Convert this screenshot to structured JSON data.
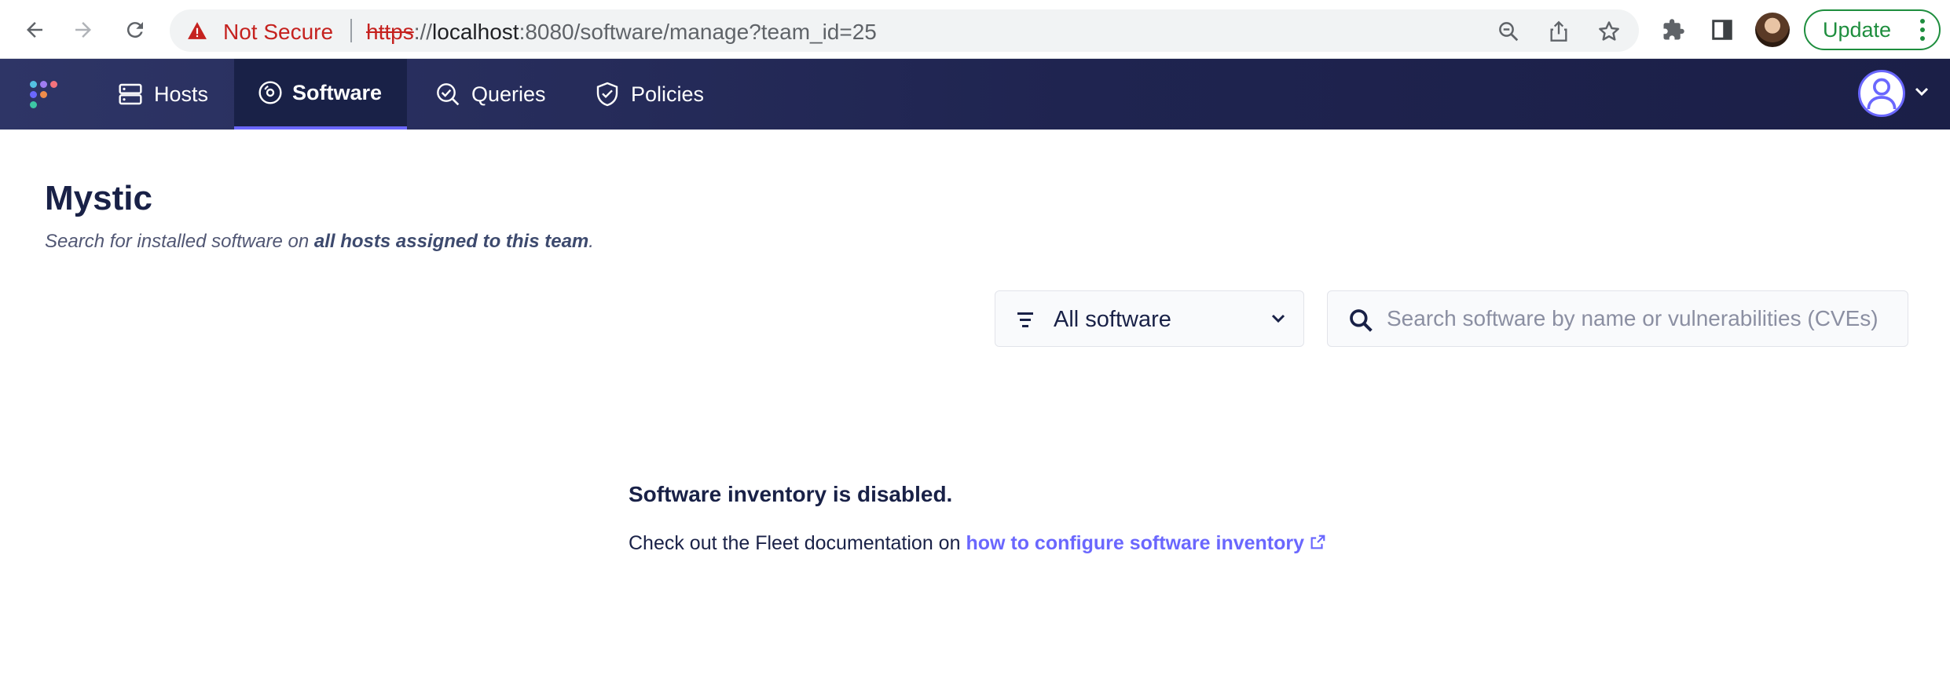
{
  "browser": {
    "security_label": "Not Secure",
    "url_scheme": "https",
    "url_sep": "://",
    "url_host": "localhost",
    "url_rest": ":8080/software/manage?team_id=25",
    "update_label": "Update"
  },
  "nav": {
    "items": [
      {
        "label": "Hosts",
        "icon": "hosts-icon"
      },
      {
        "label": "Software",
        "icon": "software-icon",
        "active": true
      },
      {
        "label": "Queries",
        "icon": "queries-icon"
      },
      {
        "label": "Policies",
        "icon": "policies-icon"
      }
    ]
  },
  "page": {
    "team_name": "Mystic",
    "subtitle_prefix": "Search for installed software on ",
    "subtitle_emphasis": "all hosts assigned to this team",
    "subtitle_suffix": "."
  },
  "filter": {
    "selected": "All software"
  },
  "search": {
    "placeholder": "Search software by name or vulnerabilities (CVEs)"
  },
  "empty_state": {
    "heading": "Software inventory is disabled.",
    "body_prefix": "Check out the Fleet documentation on ",
    "link_text": "how to configure software inventory"
  },
  "colors": {
    "nav_bg": "#1f2450",
    "accent": "#6a67fe",
    "text": "#192147",
    "warning": "#c5221f",
    "update_green": "#1e8e3e"
  }
}
